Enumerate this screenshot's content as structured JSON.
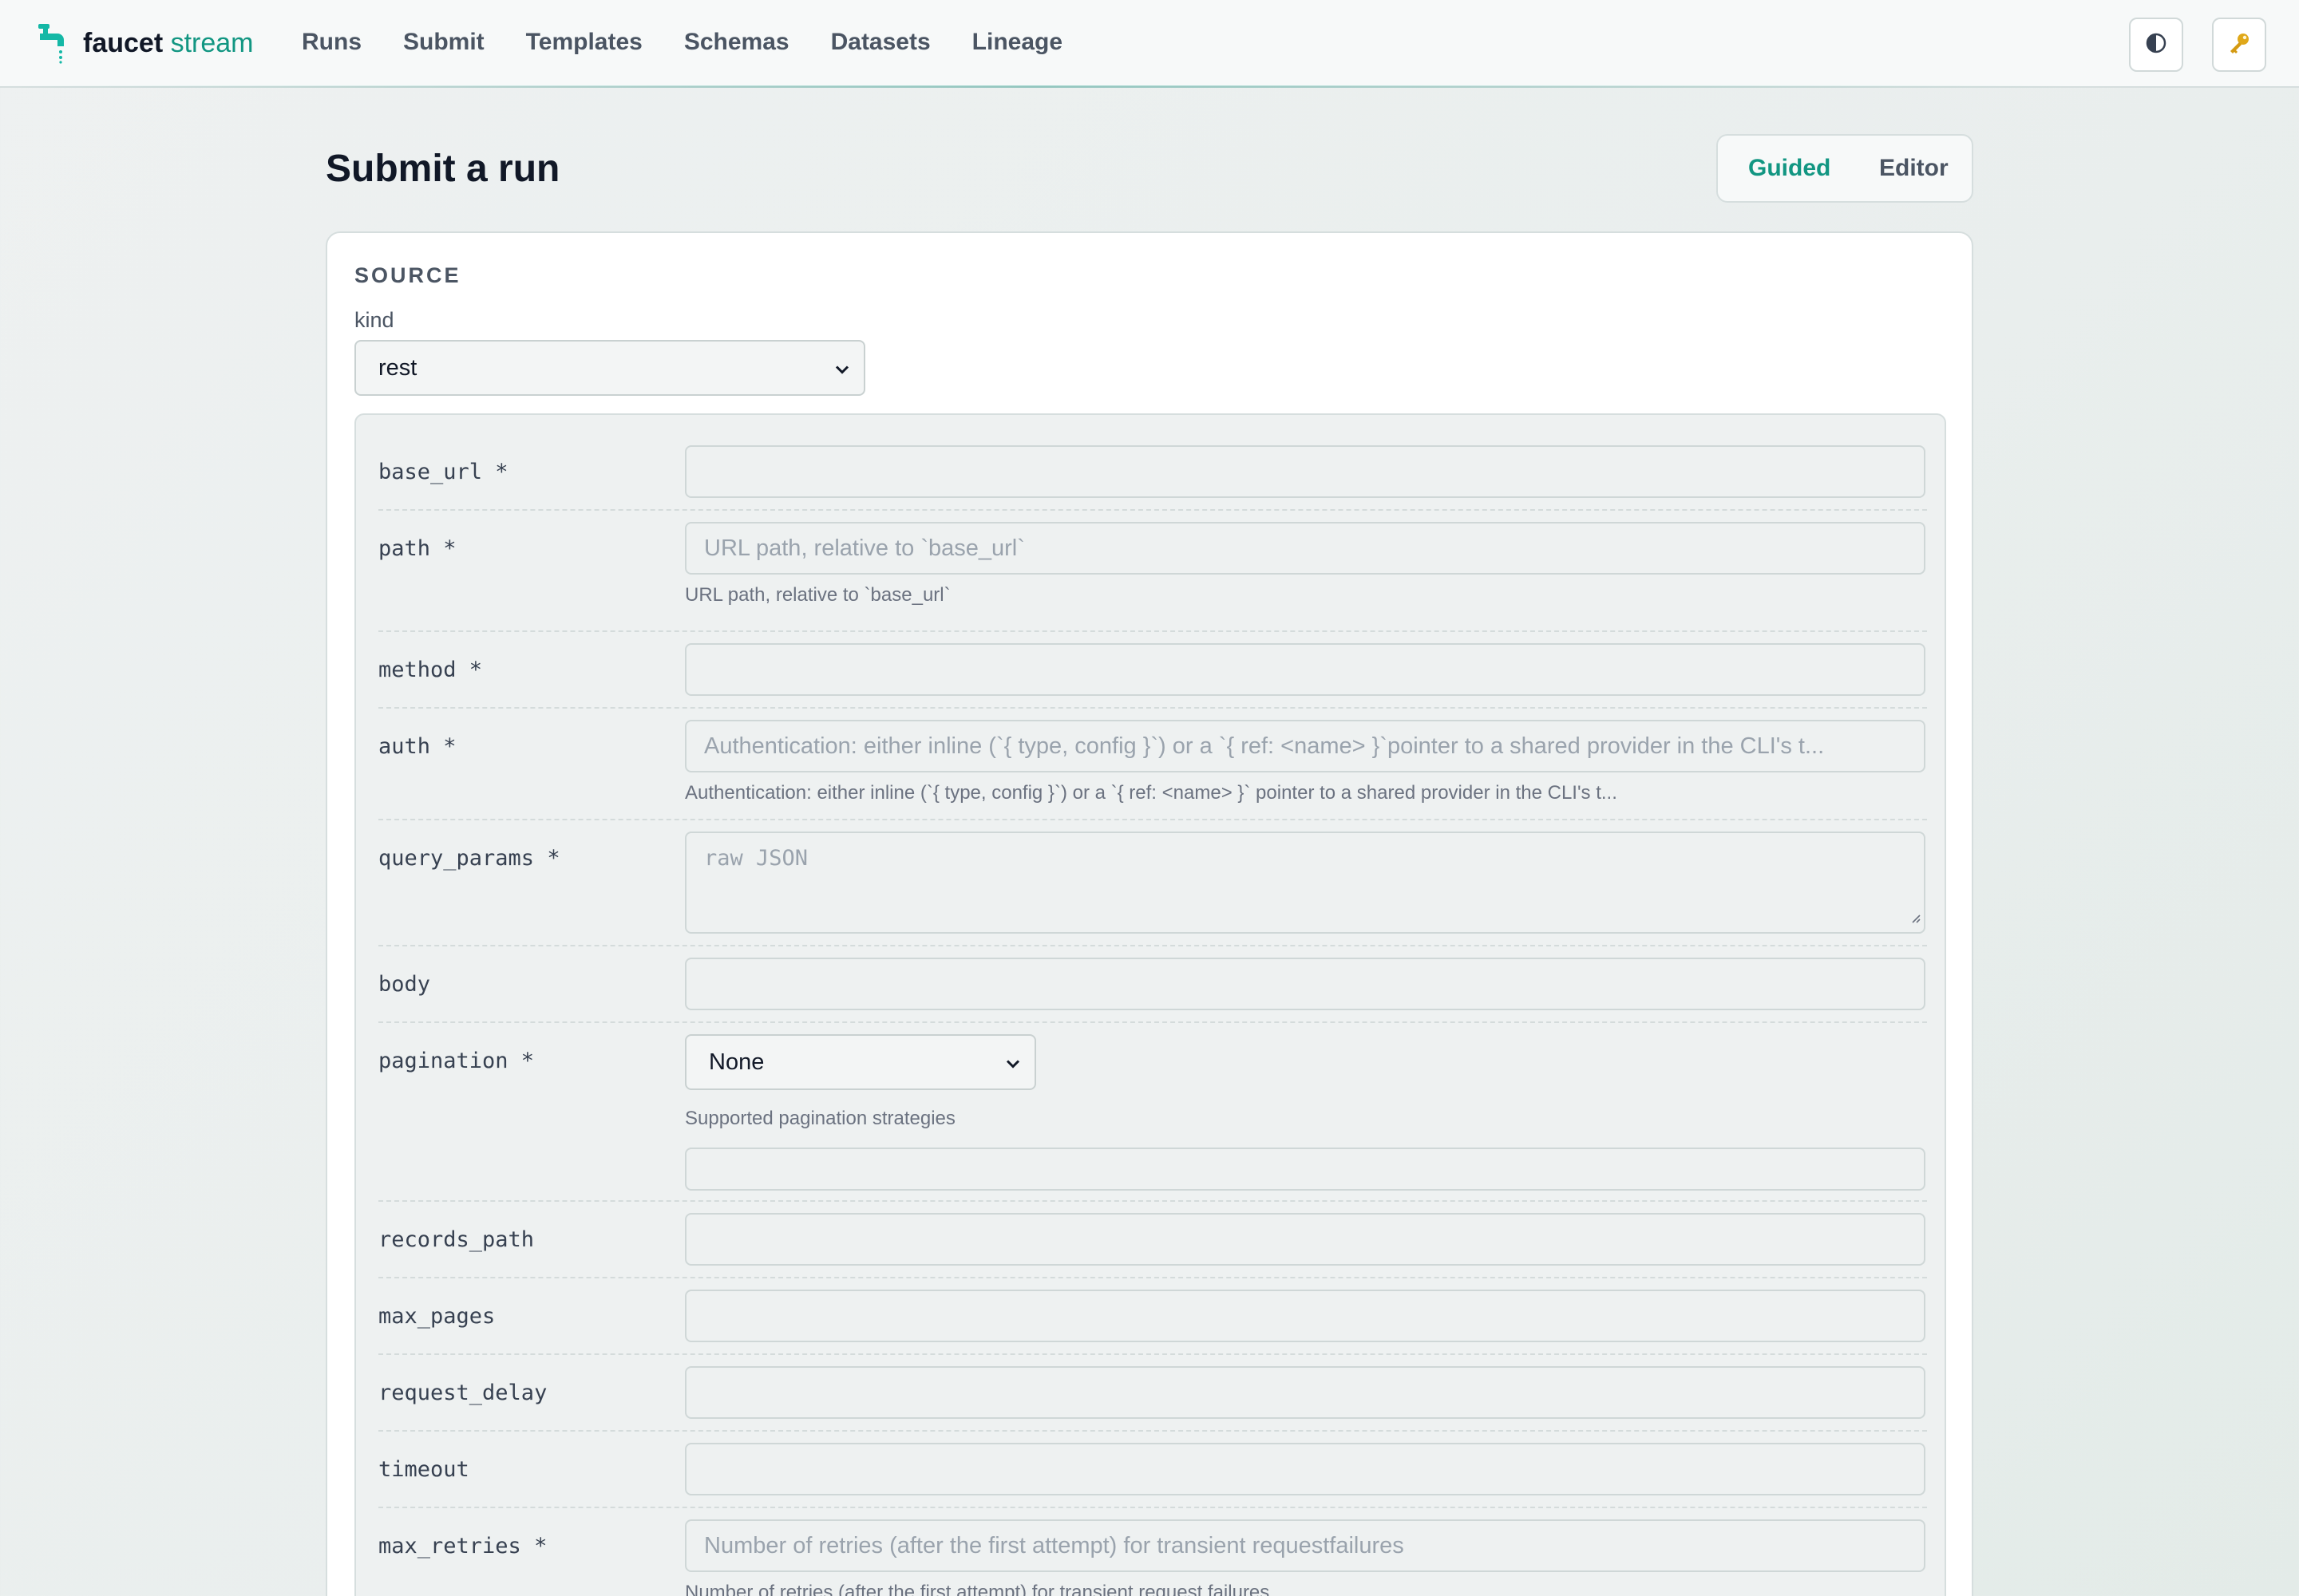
{
  "brand": {
    "name_bold": "faucet",
    "name_accent": "stream"
  },
  "nav": {
    "items": [
      "Runs",
      "Submit",
      "Templates",
      "Schemas",
      "Datasets",
      "Lineage"
    ]
  },
  "header_icons": {
    "theme": "half-circle-contrast-icon",
    "api_key": "key-icon"
  },
  "page": {
    "title": "Submit a run"
  },
  "mode_toggle": {
    "guided": "Guided",
    "editor": "Editor",
    "active": "Guided"
  },
  "source": {
    "section_title": "SOURCE",
    "kind_label": "kind",
    "kind_value": "rest",
    "fields": {
      "base_url": {
        "label": "base_url *",
        "placeholder": ""
      },
      "path": {
        "label": "path *",
        "placeholder": "URL path, relative to `base_url`",
        "help": "URL path, relative to `base_url`"
      },
      "method": {
        "label": "method *",
        "placeholder": ""
      },
      "auth": {
        "label": "auth *",
        "placeholder": "Authentication: either inline (`{ type, config }`) or a `{ ref: <name> }`pointer to a shared provider in the CLI's t...",
        "help": "Authentication: either inline (`{ type, config }`) or a `{ ref: <name> }` pointer to a shared provider in the CLI's t..."
      },
      "query_params": {
        "label": "query_params *",
        "placeholder": "raw JSON"
      },
      "body": {
        "label": "body",
        "placeholder": ""
      },
      "pagination": {
        "label": "pagination *",
        "value": "None",
        "help": "Supported pagination strategies",
        "extra_placeholder": ""
      },
      "records_path": {
        "label": "records_path",
        "placeholder": ""
      },
      "max_pages": {
        "label": "max_pages",
        "placeholder": ""
      },
      "request_delay": {
        "label": "request_delay",
        "placeholder": ""
      },
      "timeout": {
        "label": "timeout",
        "placeholder": ""
      },
      "max_retries": {
        "label": "max_retries *",
        "placeholder": "Number of retries (after the first attempt) for transient requestfailures",
        "help": "Number of retries (after the first attempt) for transient request failures"
      }
    }
  },
  "colors": {
    "accent": "#129682",
    "text": "#111827",
    "muted": "#4b5563",
    "key_icon": "#d4a017"
  }
}
